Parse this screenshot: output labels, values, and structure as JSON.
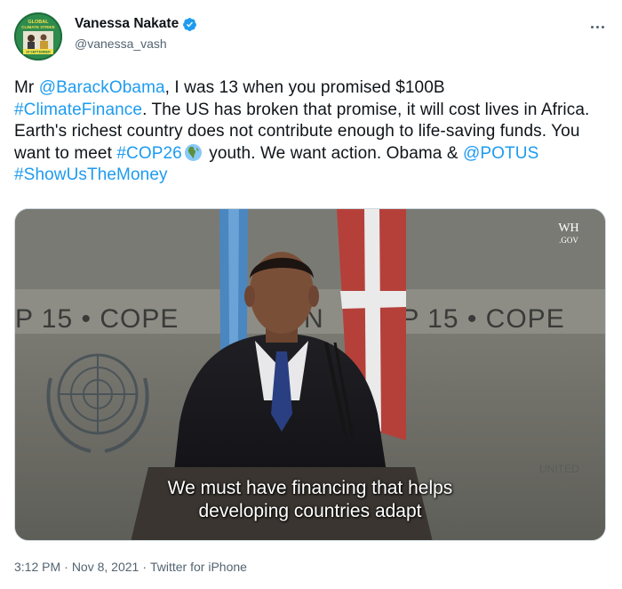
{
  "user": {
    "display_name": "Vanessa Nakate",
    "handle": "@vanessa_vash",
    "verified": true,
    "avatar_text": {
      "line1": "GLOBAL",
      "line2": "CLIMATE STRIKE",
      "line3": "24 SEPTEMBER"
    }
  },
  "tweet": {
    "segments": {
      "s1": "Mr ",
      "l1": "@BarackObama",
      "s2": ", I was 13 when you promised $100B",
      "l2": "#ClimateFinance",
      "s3": ". The US has broken that promise, it will cost lives in Africa. Earth's richest country does not contribute enough to life-saving funds. You want to meet ",
      "l3": "#COP26",
      "s4": " youth. We want action. Obama & ",
      "l4": "@POTUS",
      "s5": " ",
      "l5": "#ShowUsTheMoney"
    },
    "emoji_name": "earth-globe-africa-icon"
  },
  "media": {
    "banner_text_left": "P 15 • COPE",
    "banner_text_mid": "N",
    "banner_text_right": "OP 15 • COPE",
    "logo_wh": "WH",
    "logo_gov": ".GOV",
    "caption_line1": "We must have financing that helps",
    "caption_line2": "developing countries adapt"
  },
  "meta": {
    "time": "3:12 PM",
    "sep1": "·",
    "date": "Nov 8, 2021",
    "sep2": "·",
    "source": "Twitter for iPhone"
  },
  "colors": {
    "link": "#1d9bf0",
    "text": "#0f1419",
    "secondary": "#536471",
    "verified": "#1d9bf0"
  }
}
